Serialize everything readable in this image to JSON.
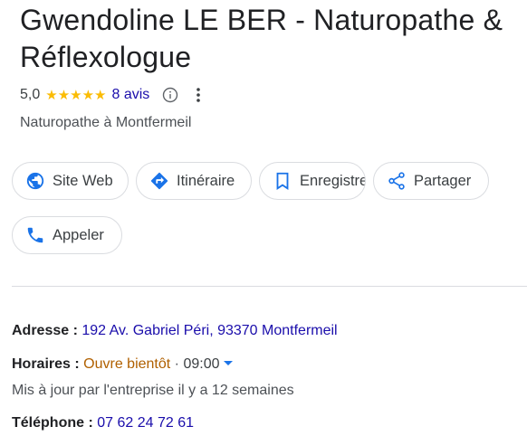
{
  "business": {
    "name": "Gwendoline LE BER - Naturopathe & Réflexologue",
    "rating": "5,0",
    "stars": "★★★★★",
    "reviews": "8 avis",
    "category": "Naturopathe à Montfermeil"
  },
  "actions": {
    "website": "Site Web",
    "directions": "Itinéraire",
    "save": "Enregistrer",
    "share": "Partager",
    "call": "Appeler"
  },
  "details": {
    "address_label": "Adresse :",
    "address": "192 Av. Gabriel Péri, 93370 Montfermeil",
    "hours_label": "Horaires :",
    "hours_status": "Ouvre bientôt",
    "hours_sep": "·",
    "hours_time": "09:00",
    "updated": "Mis à jour par l'entreprise il y a 12 semaines",
    "phone_label": "Téléphone :",
    "phone": "07 62 24 72 61"
  },
  "colors": {
    "star": "#fbbc04",
    "link": "#1a0dab",
    "accent": "#1a73e8",
    "status_soon": "#b06000"
  },
  "icons": [
    "info-icon",
    "more-vert-icon",
    "globe-icon",
    "directions-icon",
    "bookmark-icon",
    "share-icon",
    "phone-icon",
    "caret-down-icon"
  ]
}
